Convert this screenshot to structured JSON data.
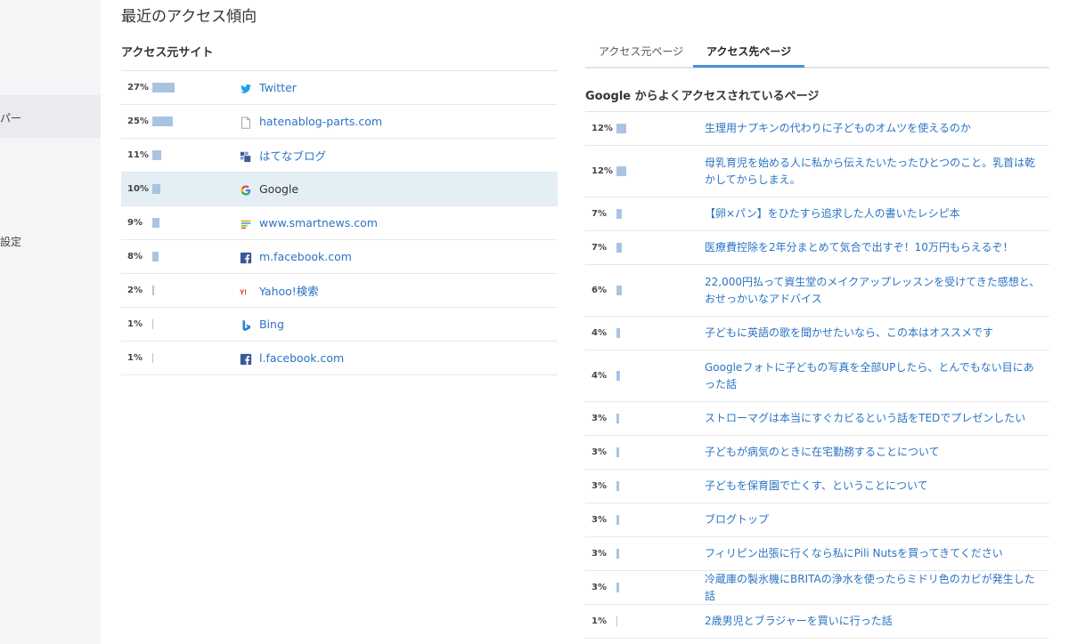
{
  "sidebar": {
    "items": [
      "パー",
      "設定"
    ]
  },
  "page_title": "最近のアクセス傾向",
  "sources": {
    "title": "アクセス元サイト",
    "rows": [
      {
        "pct": "27%",
        "value": 27,
        "icon": "twitter-icon",
        "label": "Twitter"
      },
      {
        "pct": "25%",
        "value": 25,
        "icon": "document-icon",
        "label": "hatenablog-parts.com"
      },
      {
        "pct": "11%",
        "value": 11,
        "icon": "hatena-icon",
        "label": "はてなブログ"
      },
      {
        "pct": "10%",
        "value": 10,
        "icon": "google-icon",
        "label": "Google"
      },
      {
        "pct": "9%",
        "value": 9,
        "icon": "smartnews-icon",
        "label": "www.smartnews.com"
      },
      {
        "pct": "8%",
        "value": 8,
        "icon": "facebook-icon",
        "label": "m.facebook.com"
      },
      {
        "pct": "2%",
        "value": 2,
        "icon": "yahoo-icon",
        "label": "Yahoo!検索"
      },
      {
        "pct": "1%",
        "value": 1,
        "icon": "bing-icon",
        "label": "Bing"
      },
      {
        "pct": "1%",
        "value": 1,
        "icon": "facebook-icon",
        "label": "l.facebook.com"
      }
    ]
  },
  "tabs": [
    "アクセス元ページ",
    "アクセス先ページ"
  ],
  "pages": {
    "title": "Google からよくアクセスされているページ",
    "rows": [
      {
        "pct": "12%",
        "value": 12,
        "label": "生理用ナプキンの代わりに子どものオムツを使えるのか"
      },
      {
        "pct": "12%",
        "value": 12,
        "label": "母乳育児を始める人に私から伝えたいたったひとつのこと。乳首は乾かしてからしまえ。"
      },
      {
        "pct": "7%",
        "value": 7,
        "label": "【卵×パン】をひたすら追求した人の書いたレシピ本"
      },
      {
        "pct": "7%",
        "value": 7,
        "label": "医療費控除を2年分まとめて気合で出すぞ！10万円もらえるぞ！"
      },
      {
        "pct": "6%",
        "value": 6,
        "label": "22,000円払って資生堂のメイクアップレッスンを受けてきた感想と、おせっかいなアドバイス"
      },
      {
        "pct": "4%",
        "value": 4,
        "label": "子どもに英語の歌を聞かせたいなら、この本はオススメです"
      },
      {
        "pct": "4%",
        "value": 4,
        "label": "Googleフォトに子どもの写真を全部UPしたら、とんでもない目にあった話"
      },
      {
        "pct": "3%",
        "value": 3,
        "label": "ストローマグは本当にすぐカビるという話をTEDでプレゼンしたい"
      },
      {
        "pct": "3%",
        "value": 3,
        "label": "子どもが病気のときに在宅勤務することについて"
      },
      {
        "pct": "3%",
        "value": 3,
        "label": "子どもを保育園で亡くす、ということについて"
      },
      {
        "pct": "3%",
        "value": 3,
        "label": "ブログトップ"
      },
      {
        "pct": "3%",
        "value": 3,
        "label": "フィリピン出張に行くなら私にPili Nutsを買ってきてください"
      },
      {
        "pct": "3%",
        "value": 3,
        "label": "冷蔵庫の製氷機にBRITAの浄水を使ったらミドリ色のカビが発生した話"
      },
      {
        "pct": "1%",
        "value": 1,
        "label": "2歳男児とブラジャーを買いに行った話"
      }
    ]
  }
}
